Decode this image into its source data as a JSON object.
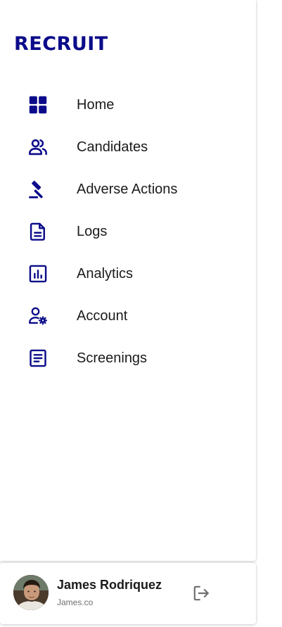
{
  "brand": {
    "logo_text": "RECRUIT",
    "accent_color": "#0b0b8a"
  },
  "nav": {
    "items": [
      {
        "label": "Home",
        "icon": "grid-icon"
      },
      {
        "label": "Candidates",
        "icon": "users-icon"
      },
      {
        "label": "Adverse Actions",
        "icon": "gavel-icon"
      },
      {
        "label": "Logs",
        "icon": "document-icon"
      },
      {
        "label": "Analytics",
        "icon": "bar-chart-icon"
      },
      {
        "label": "Account",
        "icon": "user-settings-icon"
      },
      {
        "label": "Screenings",
        "icon": "list-document-icon"
      }
    ]
  },
  "user": {
    "name": "James Rodriquez",
    "org": "James.co",
    "avatar": "avatar-photo",
    "logout_icon": "logout-icon"
  }
}
